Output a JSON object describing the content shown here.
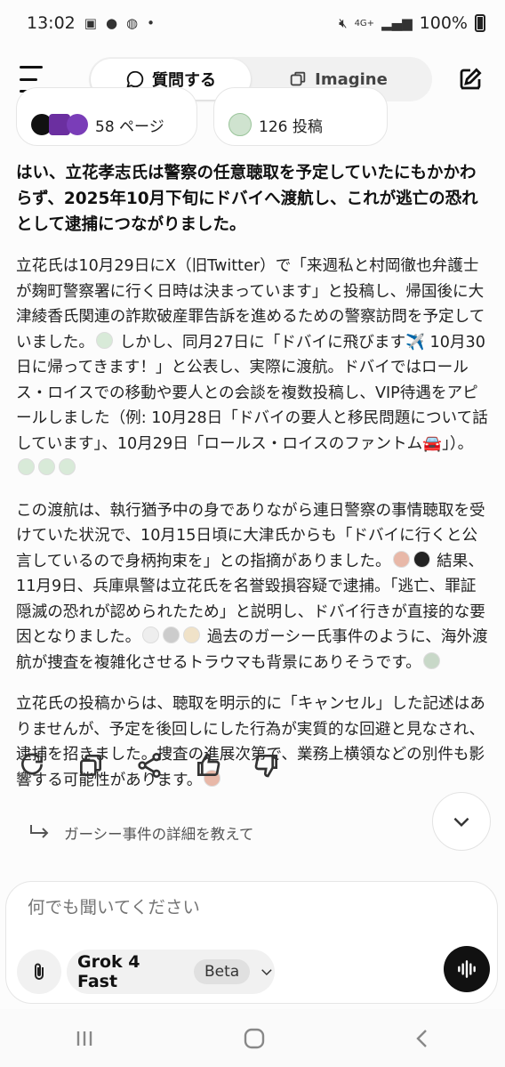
{
  "status_bar": {
    "time": "13:02",
    "battery": "100%",
    "network": "4G+"
  },
  "tabs": [
    {
      "label": "質問する",
      "active": true
    },
    {
      "label": "Imagine",
      "active": false
    }
  ],
  "sources": [
    {
      "label": "58 ページ"
    },
    {
      "label": "126 投稿"
    }
  ],
  "answer": {
    "headline": "はい、立花孝志氏は警察の任意聴取を予定していたにもかかわらず、2025年10月下旬にドバイへ渡航し、これが逃亡の恐れとして逮捕につながりました。",
    "p1": "立花氏は10月29日にX（旧Twitter）で「来週私と村岡徹也弁護士が麹町警察署に行く日時は決まっています」と投稿し、帰国後に大津綾香氏関連の詐欺破産罪告訴を進めるための警察訪問を予定していました。",
    "p1b": " しかし、同月27日に「ドバイに飛びます✈️ 10月30日に帰ってきます！」と公表し、実際に渡航。ドバイではロールス・ロイスでの移動や要人との会談を複数投稿し、VIP待遇をアピールしました（例: 10月28日「ドバイの要人と移民問題について話しています」、10月29日「ロールス・ロイスのファントム🚘」）。",
    "p2": "この渡航は、執行猶予中の身でありながら連日警察の事情聴取を受けていた状況で、10月15日頃に大津氏からも「ドバイに行くと公言しているので身柄拘束を」との指摘がありました。",
    "p2b": " 結果、11月9日、兵庫県警は立花氏を名誉毀損容疑で逮捕。「逃亡、罪証隠滅の恐れが認められたため」と説明し、ドバイ行きが直接的な要因となりました。",
    "p2c": " 過去のガーシー氏事件のように、海外渡航が捜査を複雑化させるトラウマも背景にありそうです。",
    "p3": "立花氏の投稿からは、聴取を明示的に「キャンセル」した記述はありませんが、予定を後回しにした行為が実質的な回避と見なされ、逮捕を招きました。捜査の進展次第で、業務上横領などの別件も影響する可能性があります。"
  },
  "suggestion": "ガーシー事件の詳細を教えて",
  "composer": {
    "placeholder": "何でも聞いてください",
    "model": "Grok 4 Fast",
    "badge": "Beta"
  }
}
